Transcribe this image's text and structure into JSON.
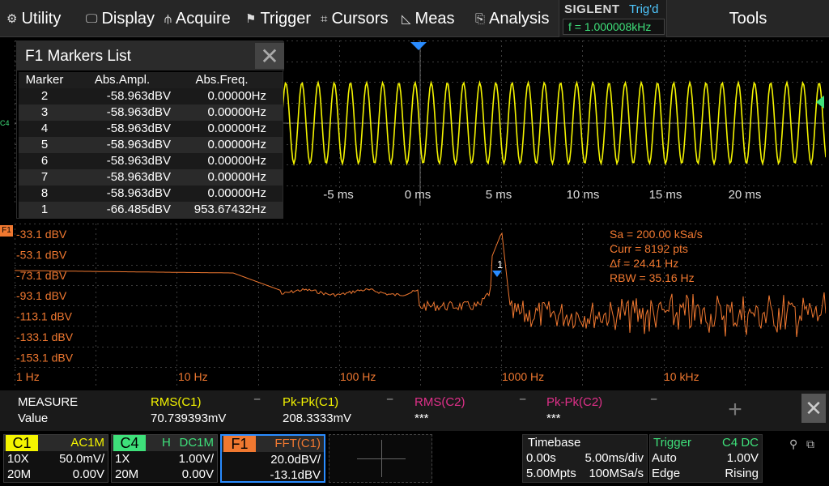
{
  "menu": {
    "items": [
      {
        "icon": "gear-icon",
        "glyph": "⚙",
        "label": "Utility"
      },
      {
        "icon": "display-icon",
        "glyph": "🖵",
        "label": "Display"
      },
      {
        "icon": "acquire-icon",
        "glyph": "⫛",
        "label": "Acquire"
      },
      {
        "icon": "trigger-icon",
        "glyph": "⚑",
        "label": "Trigger"
      },
      {
        "icon": "cursors-icon",
        "glyph": "⌗",
        "label": "Cursors"
      },
      {
        "icon": "meas-icon",
        "glyph": "◺",
        "label": "Meas"
      },
      {
        "icon": "analysis-icon",
        "glyph": "⎘",
        "label": "Analysis"
      }
    ],
    "brand": "SIGLENT",
    "trigger_state": "Trig'd",
    "frequency": "f = 1.000008kHz",
    "tools": "Tools"
  },
  "waveform": {
    "channel_tag": "C4",
    "time_ticks": [
      "-5 ms",
      "0 ms",
      "5 ms",
      "10 ms",
      "15 ms",
      "20 ms"
    ],
    "color": "#f4f400"
  },
  "fft": {
    "tag": "F1",
    "color": "#f07830",
    "level_labels": [
      "-33.1 dBV",
      "-53.1 dBV",
      "-73.1 dBV",
      "-93.1 dBV",
      "-113.1 dBV",
      "-133.1 dBV",
      "-153.1 dBV"
    ],
    "freq_labels": [
      "1 Hz",
      "10 Hz",
      "100 Hz",
      "1000 Hz",
      "10 kHz"
    ],
    "info": [
      "Sa = 200.00 kSa/s",
      "Curr = 8192 pts",
      "Δf = 24.41 Hz",
      "RBW = 35.16 Hz"
    ],
    "marker_label": "1"
  },
  "markers_list": {
    "title": "F1 Markers List",
    "headers": [
      "Marker",
      "Abs.Ampl.",
      "Abs.Freq."
    ],
    "rows": [
      [
        "2",
        "-58.963dBV",
        "0.00000Hz"
      ],
      [
        "3",
        "-58.963dBV",
        "0.00000Hz"
      ],
      [
        "4",
        "-58.963dBV",
        "0.00000Hz"
      ],
      [
        "5",
        "-58.963dBV",
        "0.00000Hz"
      ],
      [
        "6",
        "-58.963dBV",
        "0.00000Hz"
      ],
      [
        "7",
        "-58.963dBV",
        "0.00000Hz"
      ],
      [
        "8",
        "-58.963dBV",
        "0.00000Hz"
      ],
      [
        "1",
        "-66.485dBV",
        "953.67432Hz"
      ]
    ]
  },
  "measure": {
    "title": "MEASURE",
    "row_label": "Value",
    "items": [
      {
        "name": "RMS(C1)",
        "value": "70.739393mV",
        "color": "#f4f400"
      },
      {
        "name": "Pk-Pk(C1)",
        "value": "208.3333mV",
        "color": "#f4f400"
      },
      {
        "name": "RMS(C2)",
        "value": "***",
        "color": "#e0308a"
      },
      {
        "name": "Pk-Pk(C2)",
        "value": "***",
        "color": "#e0308a"
      }
    ],
    "add_glyph": "+",
    "close_glyph": "✕"
  },
  "channels": {
    "c1": {
      "name": "C1",
      "coupling": "AC1M",
      "probe": "10X",
      "scale": "50.0mV/",
      "bw": "20M",
      "offset": "0.00V",
      "color": "#f4f400"
    },
    "c4": {
      "name": "C4",
      "flag": "H",
      "coupling": "DC1M",
      "probe": "1X",
      "scale": "1.00V/",
      "bw": "20M",
      "offset": "0.00V",
      "color": "#3ee07a"
    },
    "f1": {
      "name": "F1",
      "source": "FFT(C1)",
      "scale": "20.0dBV/",
      "offset": "-13.1dBV",
      "color": "#f07830"
    }
  },
  "timebase": {
    "title": "Timebase",
    "delay": "0.00s",
    "scale": "5.00ms/div",
    "memory": "5.00Mpts",
    "rate": "100MSa/s"
  },
  "trigger": {
    "title": "Trigger",
    "source": "C4 DC",
    "mode": "Auto",
    "level": "1.00V",
    "type": "Edge",
    "slope": "Rising",
    "color": "#3ee07a"
  },
  "status": {
    "usb_icon": "⚲",
    "net_icon": "⧉"
  }
}
